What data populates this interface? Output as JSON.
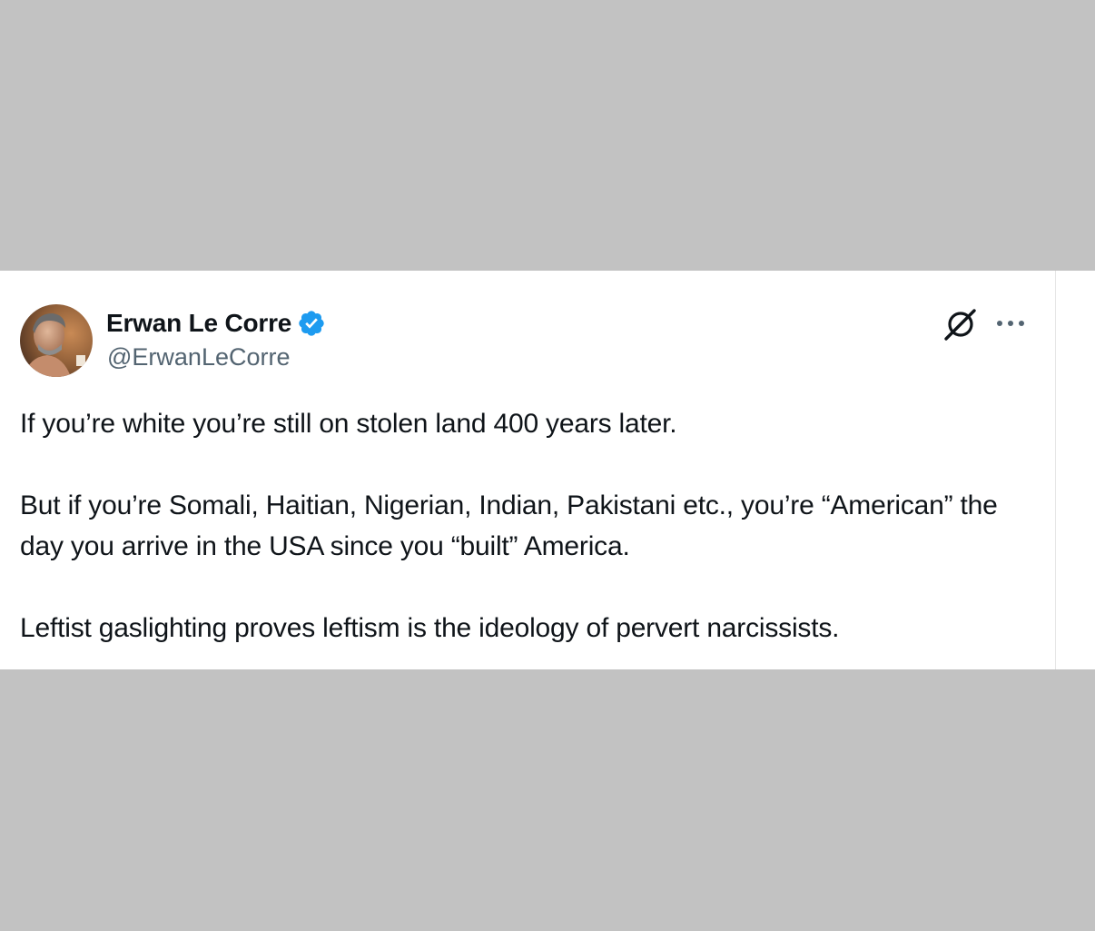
{
  "tweet": {
    "author": {
      "display_name": "Erwan Le Corre",
      "handle": "@ErwanLeCorre",
      "verified": true,
      "avatar_icon": "profile-photo"
    },
    "icons": {
      "grok": "grok-icon",
      "more": "more-options-icon"
    },
    "paragraphs": [
      "If you’re white you’re still on stolen land 400 years later.",
      "But if you’re Somali, Haitian, Nigerian, Indian, Pakistani etc., you’re “American” the day you arrive in the USA since you “built” America.",
      "Leftist gaslighting proves leftism is the ideology of pervert narcissists."
    ]
  },
  "colors": {
    "background": "#c2c2c2",
    "card": "#ffffff",
    "text": "#0f1419",
    "secondary_text": "#536471",
    "verified_badge": "#1d9bf0"
  }
}
